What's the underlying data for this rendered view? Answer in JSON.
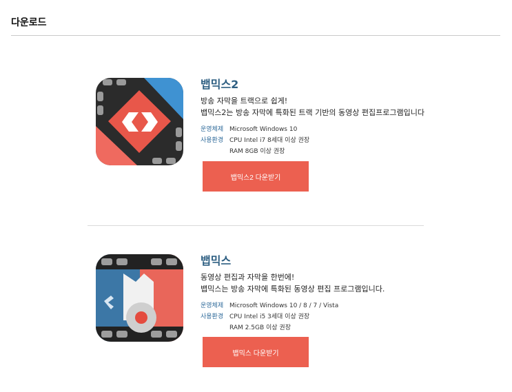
{
  "page": {
    "title": "다운로드"
  },
  "products": [
    {
      "name": "뱁믹스2",
      "tagline": "방송 자막을 트랙으로 쉽게!",
      "description": "뱁믹스2는 방송 자막에 특화된 트랙 기반의 동영상 편집프로그램입니다",
      "specs": [
        {
          "label": "운영체제",
          "value": "Microsoft Windows 10"
        },
        {
          "label": "사용환경",
          "value": "CPU Intel i7 8세대 이상 권장"
        },
        {
          "label": "",
          "value": "RAM 8GB 이상 권장"
        }
      ],
      "button": "뱁믹스2 다운받기",
      "icon": "vapmix2-app-icon",
      "colors": {
        "accent": "#ec6050",
        "blue": "#3e8fcf",
        "dark": "#2a2a2a"
      }
    },
    {
      "name": "뱁믹스",
      "tagline": "동영상 편집과 자막을 한번에!",
      "description": "뱁믹스는 방송 자막에 특화된 동영상 편집 프로그램입니다.",
      "specs": [
        {
          "label": "운영체제",
          "value": "Microsoft Windows 10 / 8 / 7 / Vista"
        },
        {
          "label": "사용환경",
          "value": "CPU Intel i5 3세대 이상 권장"
        },
        {
          "label": "",
          "value": "RAM 2.5GB 이상 권장"
        }
      ],
      "button": "뱁믹스 다운받기",
      "icon": "vapmix-app-icon",
      "colors": {
        "accent": "#ec6050",
        "blue": "#3c77a6",
        "dark": "#1d1d1d"
      }
    }
  ]
}
